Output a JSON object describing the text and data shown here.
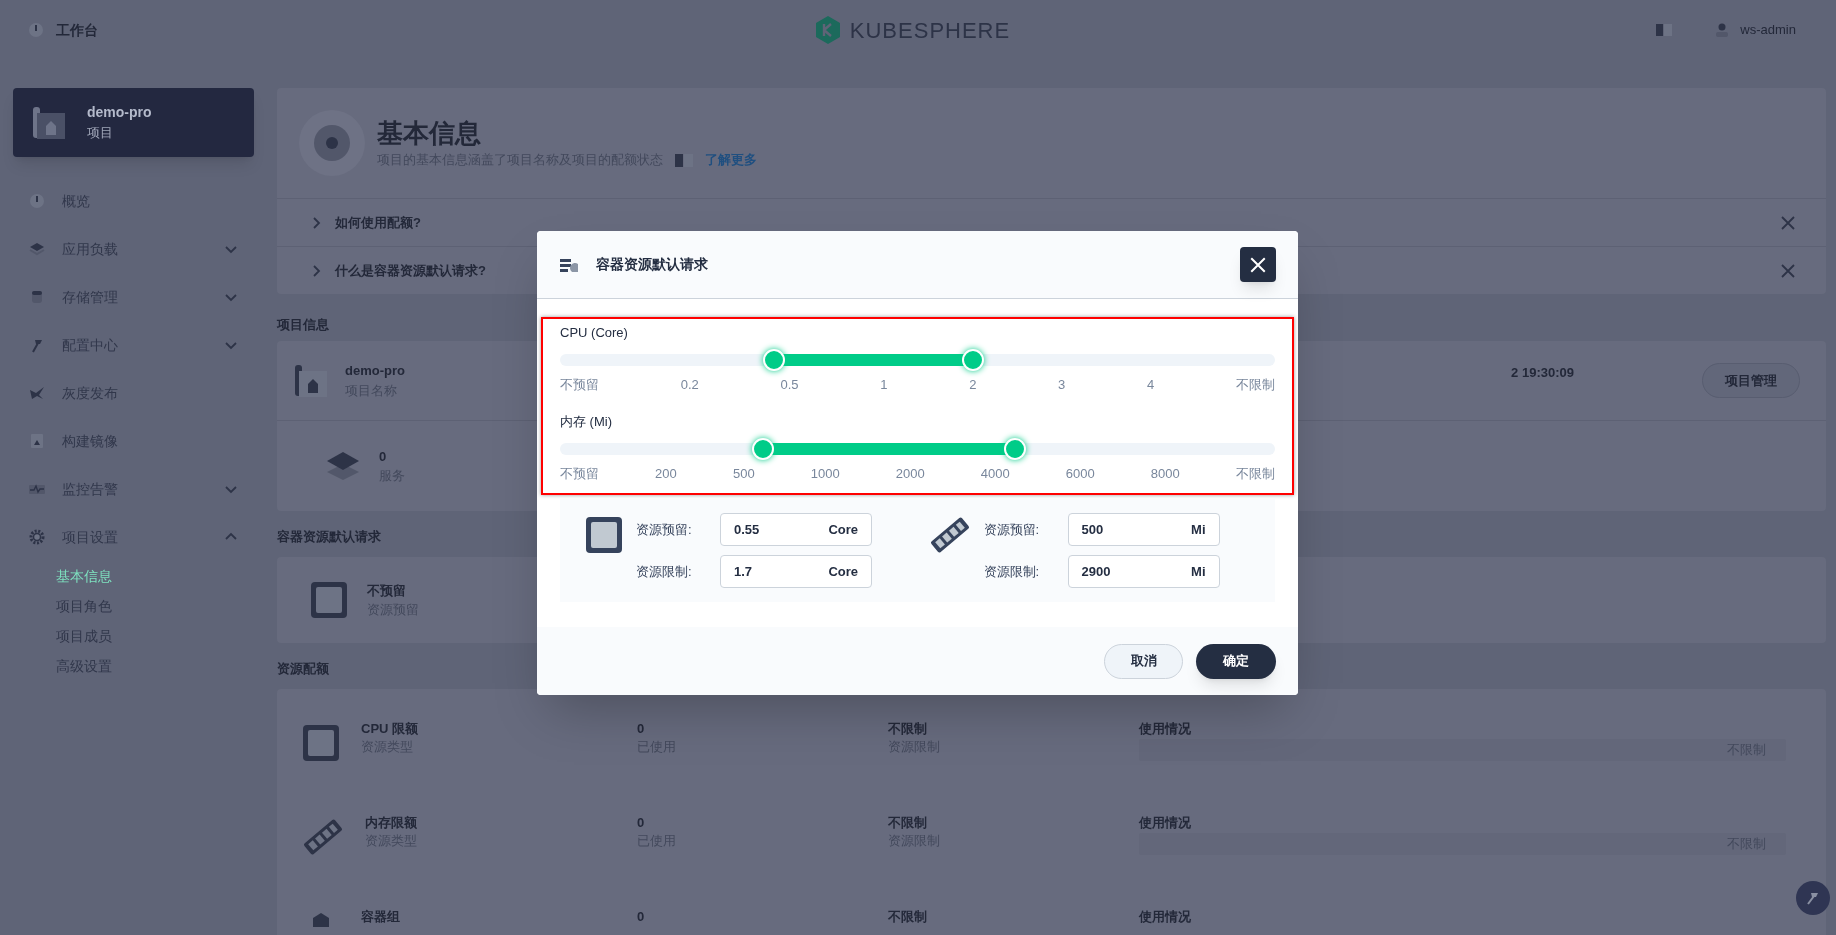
{
  "top_bar": {
    "workbench": "工作台",
    "logo": "KUBESPHERE",
    "user": "ws-admin"
  },
  "sidebar": {
    "project": {
      "name": "demo-pro",
      "type": "项目"
    },
    "items": [
      {
        "label": "概览",
        "kind": "link"
      },
      {
        "label": "应用负载",
        "kind": "group",
        "expanded": false
      },
      {
        "label": "存储管理",
        "kind": "group",
        "expanded": false
      },
      {
        "label": "配置中心",
        "kind": "group",
        "expanded": false
      },
      {
        "label": "灰度发布",
        "kind": "link"
      },
      {
        "label": "构建镜像",
        "kind": "link"
      },
      {
        "label": "监控告警",
        "kind": "group",
        "expanded": false
      },
      {
        "label": "项目设置",
        "kind": "group",
        "expanded": true,
        "children": [
          {
            "label": "基本信息",
            "selected": true
          },
          {
            "label": "项目角色",
            "selected": false
          },
          {
            "label": "项目成员",
            "selected": false
          },
          {
            "label": "高级设置",
            "selected": false
          }
        ]
      }
    ]
  },
  "header": {
    "title": "基本信息",
    "description": "项目的基本信息涵盖了项目名称及项目的配额状态",
    "link": "了解更多"
  },
  "tips": [
    {
      "label": "如何使用配额?",
      "expanded": false
    },
    {
      "label": "什么是容器资源默认请求?",
      "expanded": false
    }
  ],
  "project_info": {
    "heading": "项目信息",
    "name": "demo-pro",
    "name_label": "项目名称",
    "created_fragment": "2 19:30:09",
    "manage_button": "项目管理",
    "services_count": "0",
    "services_label": "服务"
  },
  "container_defaults": {
    "heading": "容器资源默认请求",
    "value": "不预留",
    "label": "资源预留"
  },
  "quotas": {
    "heading": "资源配额",
    "rows": [
      {
        "kind": "cpu",
        "name": "CPU 限额",
        "type_label": "资源类型",
        "used": "0",
        "used_label": "已使用",
        "limit": "不限制",
        "limit_label": "资源限制",
        "usage_label": "使用情况",
        "usage_value": "不限制"
      },
      {
        "kind": "memory",
        "name": "内存限额",
        "type_label": "资源类型",
        "used": "0",
        "used_label": "已使用",
        "limit": "不限制",
        "limit_label": "资源限制",
        "usage_label": "使用情况",
        "usage_value": "不限制"
      },
      {
        "kind": "pod",
        "name": "容器组",
        "used": "0",
        "limit": "不限制",
        "usage_label": "使用情况"
      }
    ]
  },
  "modal": {
    "title": "容器资源默认请求",
    "sliders": [
      {
        "label": "CPU (Core)",
        "thumbs": [
          {
            "level": 0.299
          },
          {
            "level": 0.578
          }
        ],
        "ticks": [
          "不预留",
          "0.2",
          "0.5",
          "1",
          "2",
          "3",
          "4",
          "不限制"
        ]
      },
      {
        "label": "内存 (Mi)",
        "thumbs": [
          {
            "level": 0.284
          },
          {
            "level": 0.636
          }
        ],
        "ticks": [
          "不预留",
          "200",
          "500",
          "1000",
          "2000",
          "4000",
          "6000",
          "8000",
          "不限制"
        ]
      }
    ],
    "resources": [
      {
        "kind": "cpu",
        "fields": [
          {
            "label": "资源预留:",
            "value": "0.55",
            "unit": "Core"
          },
          {
            "label": "资源限制:",
            "value": "1.7",
            "unit": "Core"
          }
        ]
      },
      {
        "kind": "memory",
        "fields": [
          {
            "label": "资源预留:",
            "value": "500",
            "unit": "Mi"
          },
          {
            "label": "资源限制:",
            "value": "2900",
            "unit": "Mi"
          }
        ]
      }
    ],
    "cancel": "取消",
    "confirm": "确定"
  }
}
